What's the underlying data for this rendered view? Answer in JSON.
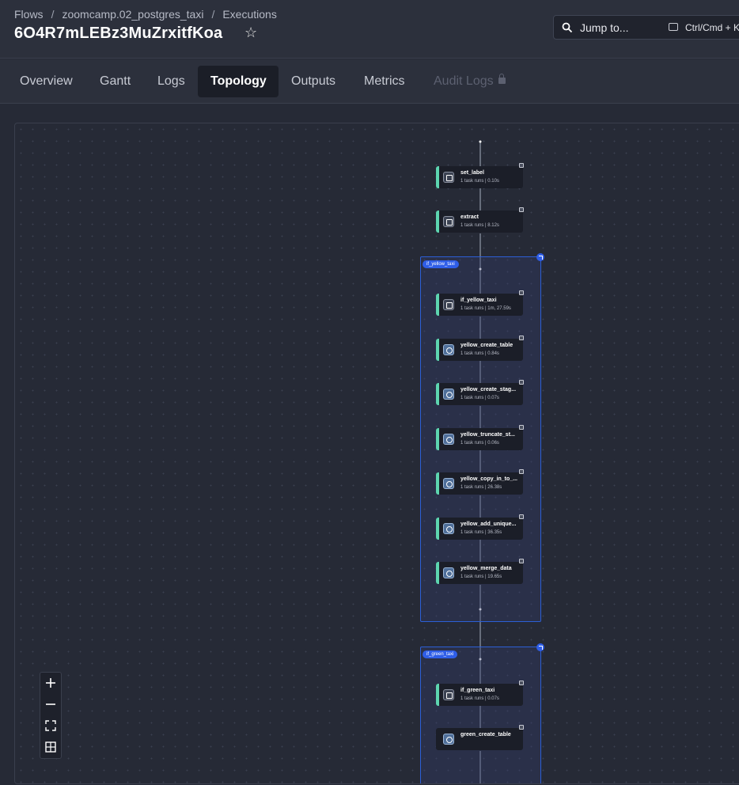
{
  "breadcrumb": [
    "Flows",
    "zoomcamp.02_postgres_taxi",
    "Executions"
  ],
  "execution_id": "6O4R7mLEBz3MuZrxitfKoa",
  "search": {
    "label": "Jump to...",
    "shortcut": "Ctrl/Cmd + K"
  },
  "tabs": [
    {
      "label": "Overview"
    },
    {
      "label": "Gantt"
    },
    {
      "label": "Logs"
    },
    {
      "label": "Topology",
      "active": true
    },
    {
      "label": "Outputs"
    },
    {
      "label": "Metrics"
    },
    {
      "label": "Audit Logs",
      "disabled": true
    }
  ],
  "topology": {
    "nodes": [
      {
        "id": "set_label",
        "status": "1 task runs | 0.10s",
        "icon": "label-icon"
      },
      {
        "id": "extract",
        "status": "1 task runs | 8.12s",
        "icon": "terminal-icon"
      }
    ],
    "clusters": [
      {
        "label": "if_yellow_taxi",
        "nodes": [
          {
            "id": "if_yellow_taxi",
            "status": "1 task runs | 1m, 27.59s",
            "icon": "branch-icon"
          },
          {
            "id": "yellow_create_table",
            "status": "1 task runs | 0.84s",
            "icon": "postgres-icon"
          },
          {
            "id": "yellow_create_stag...",
            "status": "1 task runs | 0.07s",
            "icon": "postgres-icon"
          },
          {
            "id": "yellow_truncate_st...",
            "status": "1 task runs | 0.06s",
            "icon": "postgres-icon"
          },
          {
            "id": "yellow_copy_in_to_...",
            "status": "1 task runs | 26.38s",
            "icon": "postgres-icon"
          },
          {
            "id": "yellow_add_unique...",
            "status": "1 task runs | 36.35s",
            "icon": "postgres-icon"
          },
          {
            "id": "yellow_merge_data",
            "status": "1 task runs | 19.65s",
            "icon": "postgres-icon"
          }
        ]
      },
      {
        "label": "if_green_taxi",
        "nodes": [
          {
            "id": "if_green_taxi",
            "status": "1 task runs | 0.07s",
            "icon": "branch-icon"
          },
          {
            "id": "green_create_table",
            "status": "",
            "icon": "postgres-icon"
          }
        ]
      }
    ]
  },
  "colors": {
    "success_border": "#5dd5b0",
    "cluster_border": "#2c5fd6",
    "badge": "#2f5ee8"
  }
}
